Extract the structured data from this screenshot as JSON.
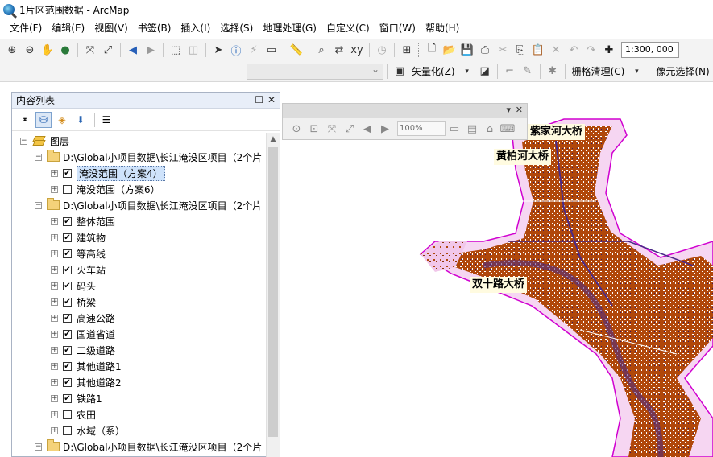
{
  "window": {
    "title": "1片区范围数据 - ArcMap"
  },
  "menu": [
    "文件(F)",
    "编辑(E)",
    "视图(V)",
    "书签(B)",
    "插入(I)",
    "选择(S)",
    "地理处理(G)",
    "自定义(C)",
    "窗口(W)",
    "帮助(H)"
  ],
  "toolbar": {
    "scale": "1:300, 000",
    "vectorize_label": "矢量化(Z)",
    "raster_cleanup_label": "栅格清理(C)",
    "pixel_select_label": "像元选择(N)"
  },
  "floating_toolbar": {
    "zoom": "100%"
  },
  "map": {
    "bridges": [
      "黄柏河大桥",
      "紫家河大桥",
      "双十路大桥"
    ],
    "colors": {
      "fill": "#b0470a",
      "outline": "#d000d0",
      "buffer": "#f3c2ee",
      "road": "#4b2a88"
    }
  },
  "toc": {
    "title": "内容列表",
    "root_label": "图层",
    "groups": [
      {
        "path": "D:\\Global小项目数据\\长江淹没区项目（2个片",
        "layers": [
          {
            "name": "淹没范围（方案4）",
            "checked": true,
            "selected": true
          },
          {
            "name": "淹没范围（方案6）",
            "checked": false
          }
        ]
      },
      {
        "path": "D:\\Global小项目数据\\长江淹没区项目（2个片",
        "layers": [
          {
            "name": "整体范围",
            "checked": true
          },
          {
            "name": "建筑物",
            "checked": true
          },
          {
            "name": "等高线",
            "checked": true
          },
          {
            "name": "火车站",
            "checked": true
          },
          {
            "name": "码头",
            "checked": true
          },
          {
            "name": "桥梁",
            "checked": true
          },
          {
            "name": "高速公路",
            "checked": true
          },
          {
            "name": "国道省道",
            "checked": true
          },
          {
            "name": "二级道路",
            "checked": true
          },
          {
            "name": "其他道路1",
            "checked": true
          },
          {
            "name": "其他道路2",
            "checked": true
          },
          {
            "name": "铁路1",
            "checked": true
          },
          {
            "name": "农田",
            "checked": false
          },
          {
            "name": "水域（系）",
            "checked": false
          }
        ]
      },
      {
        "path": "D:\\Global小项目数据\\长江淹没区项目（2个片",
        "layers": []
      }
    ]
  }
}
